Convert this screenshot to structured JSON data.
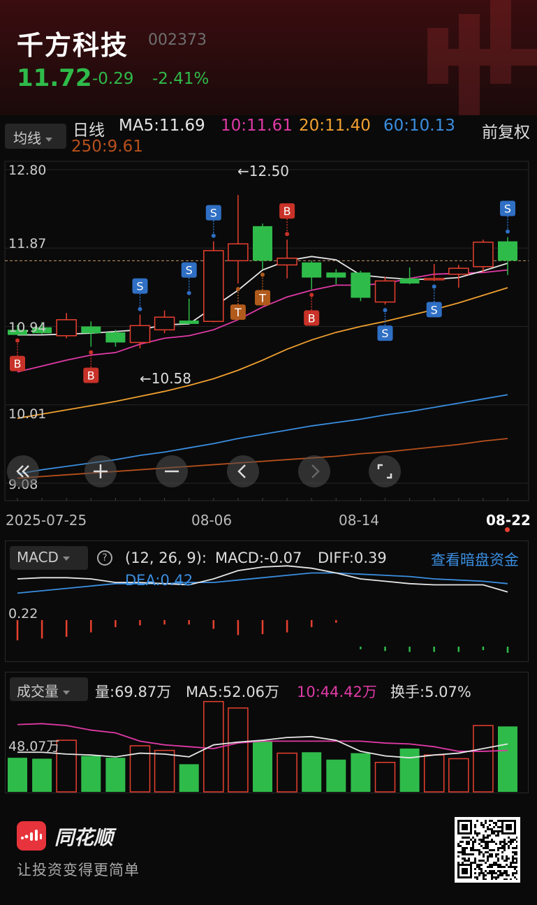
{
  "stock": {
    "name": "千方科技",
    "code": "002373",
    "price": "11.72",
    "change": "-0.29",
    "change_pct": "-2.41%"
  },
  "ma_legend": {
    "selector": "均线",
    "period": "日线",
    "ma5": "MA5:11.69",
    "ma10": "10:11.61",
    "ma20": "20:11.40",
    "ma60": "60:10.13",
    "ma250": "250:9.61",
    "adjust": "前复权"
  },
  "colors": {
    "up": "#e8402f",
    "down": "#2fbb4a",
    "ma5": "#e6e6e6",
    "ma10": "#e03aa6",
    "ma20": "#f0a030",
    "ma60": "#3a8ee0",
    "ma250": "#b8501c"
  },
  "controls": [
    "double-left-icon",
    "plus-icon",
    "minus-icon",
    "chevron-left-icon",
    "chevron-right-icon",
    "fullscreen-icon"
  ],
  "chart_data": {
    "type": "candlestick",
    "y_ticks": [
      "12.80",
      "11.87",
      "10.94",
      "10.01",
      "9.08"
    ],
    "ylim": [
      9.08,
      12.8
    ],
    "x_labels": [
      "2025-07-25",
      "08-06",
      "08-14",
      "08-22"
    ],
    "last_price_line": 11.72,
    "max_label": "←12.50",
    "min_label": "←10.58",
    "candles": [
      {
        "o": 10.9,
        "h": 10.96,
        "l": 10.84,
        "c": 10.84
      },
      {
        "o": 10.93,
        "h": 10.99,
        "l": 10.85,
        "c": 10.86
      },
      {
        "o": 10.83,
        "h": 11.1,
        "l": 10.8,
        "c": 11.02
      },
      {
        "o": 10.94,
        "h": 11.0,
        "l": 10.7,
        "c": 10.86
      },
      {
        "o": 10.87,
        "h": 10.9,
        "l": 10.7,
        "c": 10.75
      },
      {
        "o": 10.75,
        "h": 11.08,
        "l": 10.68,
        "c": 10.95
      },
      {
        "o": 10.9,
        "h": 11.13,
        "l": 10.86,
        "c": 11.05
      },
      {
        "o": 11.01,
        "h": 11.27,
        "l": 10.99,
        "c": 10.97
      },
      {
        "o": 11.0,
        "h": 11.95,
        "l": 10.99,
        "c": 11.84
      },
      {
        "o": 11.72,
        "h": 12.5,
        "l": 11.45,
        "c": 11.92
      },
      {
        "o": 12.13,
        "h": 12.16,
        "l": 11.62,
        "c": 11.72
      },
      {
        "o": 11.67,
        "h": 11.97,
        "l": 11.51,
        "c": 11.75
      },
      {
        "o": 11.7,
        "h": 11.72,
        "l": 11.38,
        "c": 11.52
      },
      {
        "o": 11.58,
        "h": 11.62,
        "l": 11.44,
        "c": 11.52
      },
      {
        "o": 11.58,
        "h": 11.6,
        "l": 11.24,
        "c": 11.28
      },
      {
        "o": 11.23,
        "h": 11.53,
        "l": 11.2,
        "c": 11.48
      },
      {
        "o": 11.51,
        "h": 11.64,
        "l": 11.44,
        "c": 11.45
      },
      {
        "o": 11.51,
        "h": 11.68,
        "l": 11.48,
        "c": 11.51
      },
      {
        "o": 11.56,
        "h": 11.67,
        "l": 11.4,
        "c": 11.63
      },
      {
        "o": 11.65,
        "h": 11.97,
        "l": 11.58,
        "c": 11.94
      },
      {
        "o": 11.95,
        "h": 12.0,
        "l": 11.55,
        "c": 11.72
      }
    ],
    "ma5": [
      10.84,
      10.84,
      10.85,
      10.86,
      10.88,
      10.9,
      10.96,
      10.97,
      11.17,
      11.37,
      11.61,
      11.72,
      11.77,
      11.73,
      11.55,
      11.52,
      11.5,
      11.5,
      11.52,
      11.6,
      11.69
    ],
    "ma10": [
      10.4,
      10.47,
      10.54,
      10.6,
      10.63,
      10.73,
      10.8,
      10.83,
      10.9,
      11.02,
      11.17,
      11.29,
      11.37,
      11.43,
      11.43,
      11.45,
      11.51,
      11.56,
      11.57,
      11.58,
      11.61
    ],
    "ma20": [
      9.85,
      9.9,
      9.95,
      10.0,
      10.05,
      10.11,
      10.17,
      10.24,
      10.32,
      10.42,
      10.54,
      10.67,
      10.78,
      10.87,
      10.94,
      11.0,
      11.07,
      11.14,
      11.22,
      11.31,
      11.4
    ],
    "ma60": [
      9.19,
      9.24,
      9.28,
      9.32,
      9.36,
      9.41,
      9.45,
      9.5,
      9.55,
      9.61,
      9.66,
      9.71,
      9.76,
      9.8,
      9.84,
      9.89,
      9.93,
      9.98,
      10.03,
      10.08,
      10.13
    ],
    "ma250": [
      9.14,
      9.16,
      9.18,
      9.2,
      9.22,
      9.24,
      9.26,
      9.28,
      9.3,
      9.32,
      9.34,
      9.36,
      9.38,
      9.4,
      9.43,
      9.45,
      9.48,
      9.51,
      9.54,
      9.58,
      9.61
    ],
    "signals": [
      {
        "i": 0,
        "t": "B",
        "pos": "below"
      },
      {
        "i": 3,
        "t": "B",
        "pos": "below"
      },
      {
        "i": 5,
        "t": "S",
        "pos": "above"
      },
      {
        "i": 7,
        "t": "S",
        "pos": "above"
      },
      {
        "i": 8,
        "t": "S",
        "pos": "above"
      },
      {
        "i": 9,
        "t": "T",
        "pos": "below"
      },
      {
        "i": 10,
        "t": "T",
        "pos": "below"
      },
      {
        "i": 11,
        "t": "B",
        "pos": "above"
      },
      {
        "i": 12,
        "t": "B",
        "pos": "below"
      },
      {
        "i": 15,
        "t": "S",
        "pos": "below"
      },
      {
        "i": 17,
        "t": "S",
        "pos": "below"
      },
      {
        "i": 20,
        "t": "S",
        "pos": "above"
      }
    ],
    "macd": {
      "selector": "MACD",
      "help_icon": "question-icon",
      "params": "(12, 26, 9):",
      "macd_label": "MACD:-0.07",
      "diff_label": "DIFF:0.39",
      "dea_label": "DEA:0.42",
      "link": "查看暗盘资金",
      "axis_label": "0.22",
      "hist": [
        0.23,
        0.21,
        0.19,
        0.14,
        0.08,
        0.06,
        0.05,
        0.05,
        0.1,
        0.17,
        0.16,
        0.14,
        0.08,
        0.03,
        -0.03,
        -0.05,
        -0.06,
        -0.06,
        -0.06,
        -0.04,
        -0.07
      ],
      "diff": [
        0.5,
        0.51,
        0.51,
        0.5,
        0.47,
        0.47,
        0.46,
        0.45,
        0.5,
        0.57,
        0.6,
        0.61,
        0.59,
        0.55,
        0.5,
        0.48,
        0.46,
        0.45,
        0.45,
        0.45,
        0.39
      ],
      "dea": [
        0.38,
        0.4,
        0.42,
        0.44,
        0.46,
        0.46,
        0.46,
        0.47,
        0.47,
        0.49,
        0.51,
        0.53,
        0.55,
        0.55,
        0.54,
        0.53,
        0.52,
        0.5,
        0.49,
        0.48,
        0.46
      ]
    },
    "volume": {
      "selector": "成交量",
      "vol_label": "量:69.87万",
      "ma5_label": "MA5:52.06万",
      "ma10_label": "10:44.42万",
      "turnover": "换手:5.07%",
      "axis_label": "48.07万",
      "bars": [
        37,
        36,
        56,
        39,
        37,
        50,
        45,
        30,
        98,
        91,
        55,
        42,
        43,
        35,
        42,
        32,
        47,
        40,
        36,
        72,
        71
      ],
      "ma5": [
        43,
        43,
        41,
        40,
        38,
        42,
        41,
        38,
        51,
        54,
        56,
        59,
        60,
        56,
        44,
        39,
        37,
        40,
        42,
        47,
        52
      ],
      "ma10": [
        73,
        74,
        72,
        67,
        64,
        55,
        51,
        49,
        47,
        53,
        55,
        55,
        55,
        55,
        55,
        53,
        52,
        49,
        44,
        44,
        45
      ]
    }
  },
  "footer": {
    "brand": "同花顺",
    "slogan": "让投资变得更简单"
  }
}
